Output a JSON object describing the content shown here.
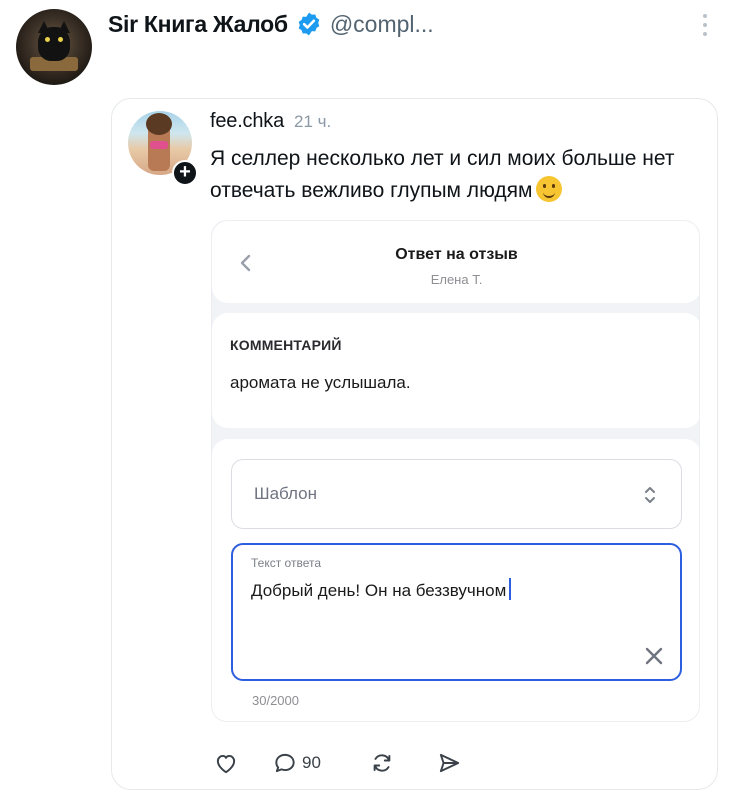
{
  "outer_post": {
    "author_name": "Sir Книга Жалоб",
    "handle": "@compl...",
    "verified": true
  },
  "quoted_post": {
    "author_name": "fee.chka",
    "time": "21 ч.",
    "text": "Я селлер несколько лет и сил моих больше нет отвечать вежливо глупым людям",
    "emoji": "melting-face"
  },
  "screenshot": {
    "header": {
      "title": "Ответ на отзыв",
      "subtitle": "Елена Т."
    },
    "comment": {
      "label": "КОММЕНТАРИЙ",
      "text": "аромата не услышала."
    },
    "template_select": {
      "value": "Шаблон"
    },
    "answer": {
      "label": "Текст ответа",
      "value": "Добрый день! Он на беззвучном",
      "char_count": "30/2000"
    }
  },
  "actions": {
    "reply_count": "90"
  },
  "colors": {
    "verified_blue": "#1d9bf0",
    "focus_blue": "#2e5ee0",
    "muted_text": "#536471"
  }
}
